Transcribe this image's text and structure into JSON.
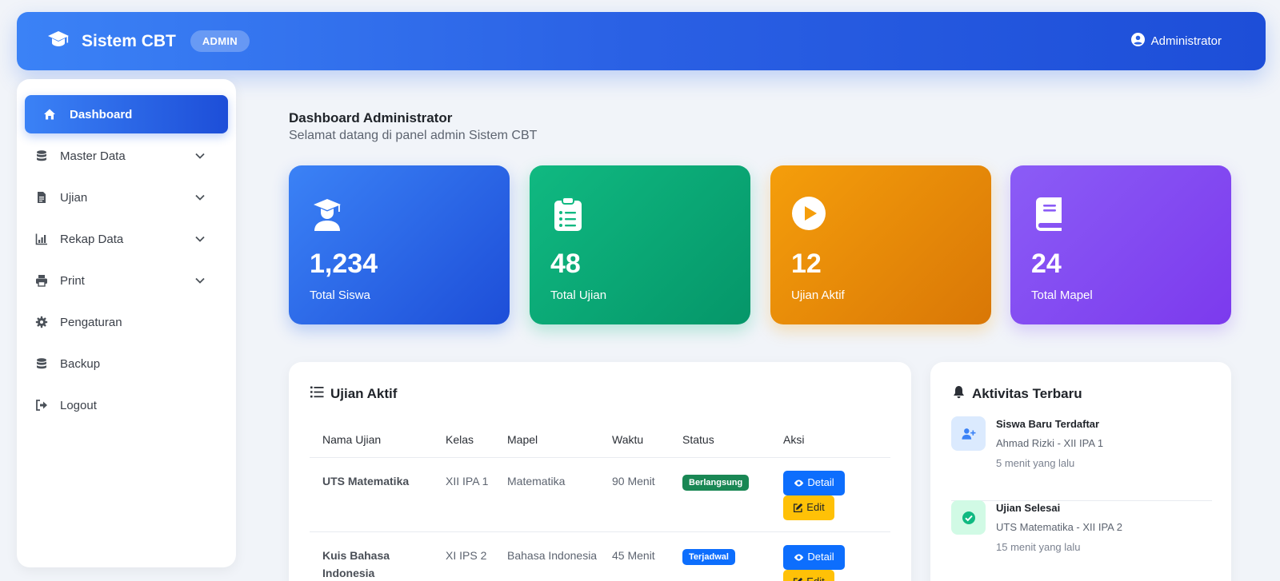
{
  "header": {
    "brand": "Sistem CBT",
    "role_badge": "ADMIN",
    "user_name": "Administrator"
  },
  "sidebar": {
    "items": [
      {
        "label": "Dashboard",
        "icon": "home-icon",
        "active": true
      },
      {
        "label": "Master Data",
        "icon": "database-icon",
        "expandable": true
      },
      {
        "label": "Ujian",
        "icon": "file-icon",
        "expandable": true
      },
      {
        "label": "Rekap Data",
        "icon": "bar-chart-icon",
        "expandable": true
      },
      {
        "label": "Print",
        "icon": "printer-icon",
        "expandable": true
      },
      {
        "label": "Pengaturan",
        "icon": "gear-icon"
      },
      {
        "label": "Backup",
        "icon": "database-icon"
      },
      {
        "label": "Logout",
        "icon": "logout-icon"
      }
    ]
  },
  "page": {
    "title": "Dashboard Administrator",
    "subtitle": "Selamat datang di panel admin Sistem CBT"
  },
  "stats": [
    {
      "value": "1,234",
      "label": "Total Siswa",
      "icon": "graduate-icon",
      "color": "#2563eb"
    },
    {
      "value": "48",
      "label": "Total Ujian",
      "icon": "clipboard-list-icon",
      "color": "#10b981"
    },
    {
      "value": "12",
      "label": "Ujian Aktif",
      "icon": "play-circle-icon",
      "color": "#f59e0b"
    },
    {
      "value": "24",
      "label": "Total Mapel",
      "icon": "book-icon",
      "color": "#8b5cf6"
    }
  ],
  "exams": {
    "title": "Ujian Aktif",
    "columns": [
      "Nama Ujian",
      "Kelas",
      "Mapel",
      "Waktu",
      "Status",
      "Aksi"
    ],
    "rows": [
      {
        "name": "UTS Matematika",
        "kelas": "XII IPA 1",
        "mapel": "Matematika",
        "waktu": "90 Menit",
        "status": "Berlangsung",
        "status_color": "#198754"
      },
      {
        "name": "Kuis Bahasa Indonesia",
        "kelas": "XI IPS 2",
        "mapel": "Bahasa Indonesia",
        "waktu": "45 Menit",
        "status": "Terjadwal",
        "status_color": "#0d6efd"
      }
    ],
    "detail_label": "Detail",
    "edit_label": "Edit"
  },
  "activity": {
    "title": "Aktivitas Terbaru",
    "items": [
      {
        "title": "Siswa Baru Terdaftar",
        "desc": "Ahmad Rizki - XII IPA 1",
        "time": "5 menit yang lalu",
        "icon": "user-plus-icon"
      },
      {
        "title": "Ujian Selesai",
        "desc": "UTS Matematika - XII IPA 2",
        "time": "15 menit yang lalu",
        "icon": "check-circle-icon"
      }
    ]
  }
}
